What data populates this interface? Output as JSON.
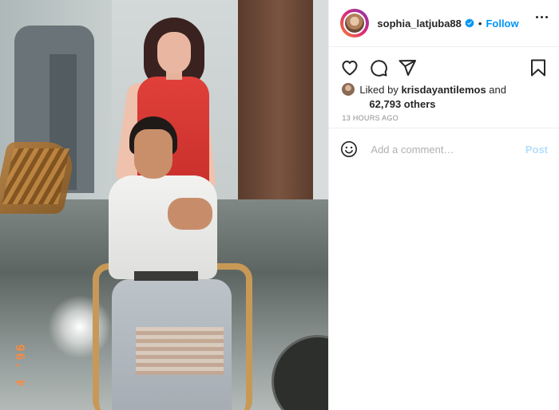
{
  "photo": {
    "date_stamp": "4 '96"
  },
  "header": {
    "username": "sophia_latjuba88",
    "separator": "•",
    "follow_label": "Follow"
  },
  "likes": {
    "prefix": "Liked by",
    "liker": "krisdayantilemos",
    "conjunction": "and",
    "count_text": "62,793 others"
  },
  "timestamp": "13 HOURS AGO",
  "comment": {
    "placeholder": "Add a comment…",
    "post_label": "Post"
  },
  "colors": {
    "accent": "#0095f6",
    "post_disabled": "#b2dffc",
    "muted": "#8e8e8e"
  },
  "icons": [
    "heart-icon",
    "comment-icon",
    "share-icon",
    "bookmark-icon",
    "verified-badge-icon",
    "emoji-icon",
    "more-options-icon"
  ]
}
